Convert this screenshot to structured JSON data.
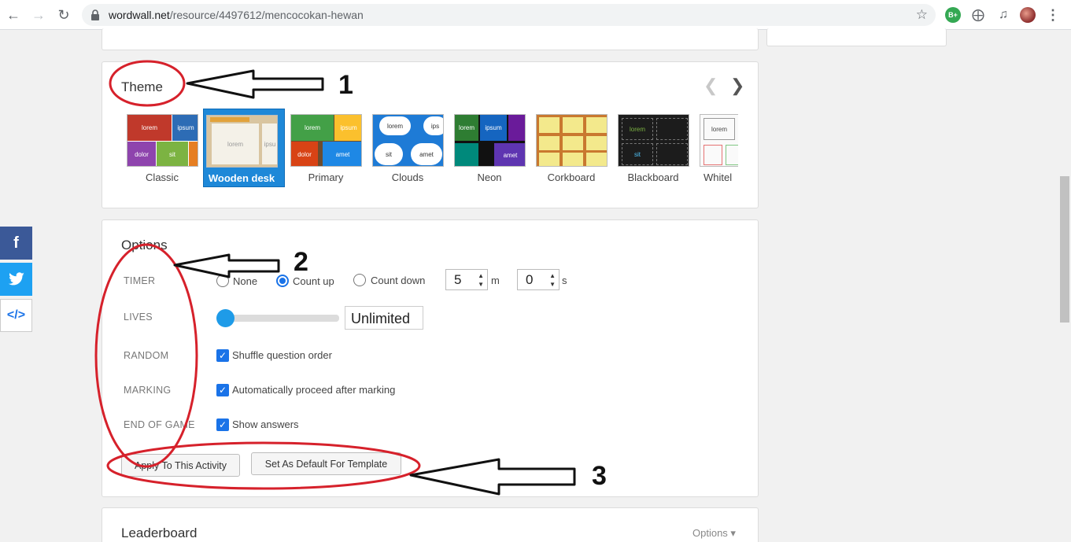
{
  "browser": {
    "url_host": "wordwall.net",
    "url_path": "/resource/4497612/mencocokan-hewan",
    "ext_badge": "B+"
  },
  "theme": {
    "title": "Theme",
    "tiles": [
      {
        "name": "Classic",
        "selected": false
      },
      {
        "name": "Wooden desk",
        "selected": true
      },
      {
        "name": "Primary",
        "selected": false
      },
      {
        "name": "Clouds",
        "selected": false
      },
      {
        "name": "Neon",
        "selected": false
      },
      {
        "name": "Corkboard",
        "selected": false
      },
      {
        "name": "Blackboard",
        "selected": false
      },
      {
        "name": "Whitel",
        "selected": false
      }
    ],
    "thumb_words": {
      "lorem": "lorem",
      "ipsum": "ipsum",
      "ipsu": "ipsu",
      "ips": "ips",
      "dolor": "dolor",
      "sit": "sit",
      "amet": "amet"
    }
  },
  "options": {
    "title": "Options",
    "timer": {
      "label": "TIMER",
      "none": "None",
      "count_up": "Count up",
      "count_down": "Count down",
      "selected": "count_up",
      "minutes": "5",
      "minutes_unit": "m",
      "seconds": "0",
      "seconds_unit": "s"
    },
    "lives": {
      "label": "LIVES",
      "value": "Unlimited"
    },
    "random": {
      "label": "RANDOM",
      "text": "Shuffle question order",
      "checked": true
    },
    "marking": {
      "label": "MARKING",
      "text": "Automatically proceed after marking",
      "checked": true
    },
    "end_of_game": {
      "label": "END OF GAME",
      "text": "Show answers",
      "checked": true
    },
    "apply_button": "Apply To This Activity",
    "default_button": "Set As Default For Template"
  },
  "leaderboard": {
    "title": "Leaderboard",
    "options_link": "Options ▾"
  },
  "annotations": {
    "n1": "1",
    "n2": "2",
    "n3": "3"
  },
  "colors": {
    "accent": "#1a73e8",
    "selected_tile": "#1e88d8",
    "annotation_red": "#d6212b"
  }
}
